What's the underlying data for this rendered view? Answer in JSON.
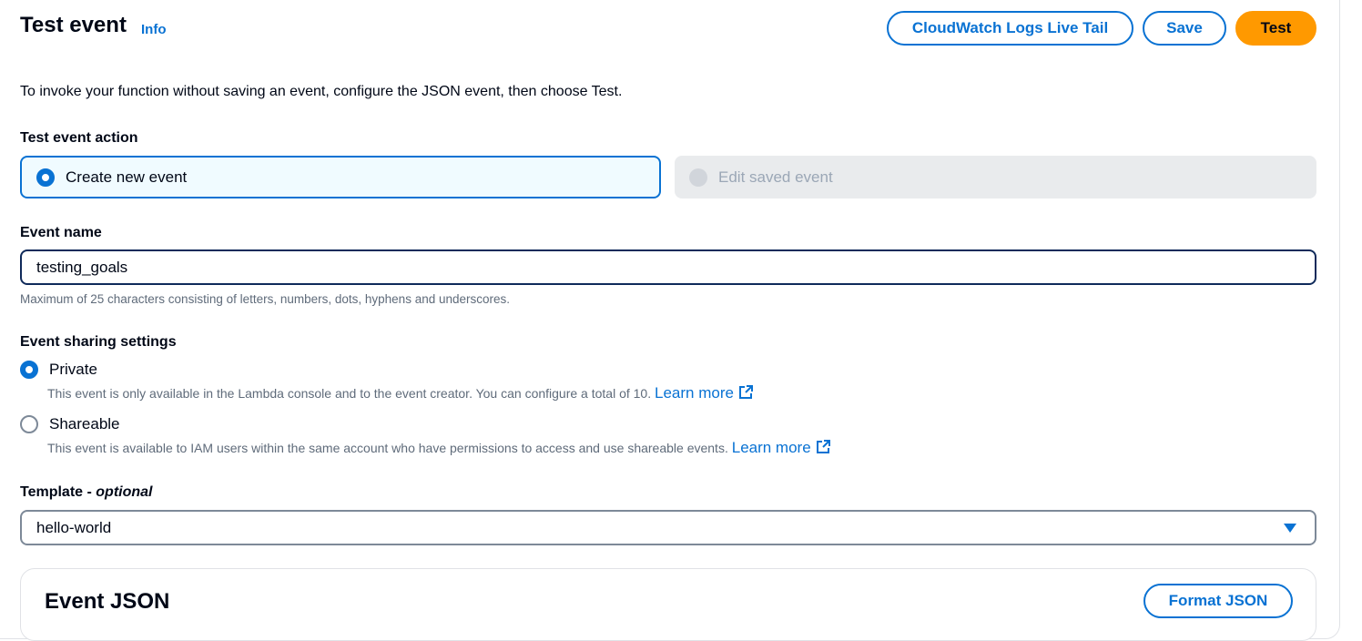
{
  "header": {
    "title": "Test event",
    "info_link": "Info",
    "buttons": {
      "live_tail": "CloudWatch Logs Live Tail",
      "save": "Save",
      "test": "Test"
    }
  },
  "description": "To invoke your function without saving an event, configure the JSON event, then choose Test.",
  "test_event_action": {
    "label": "Test event action",
    "options": [
      {
        "label": "Create new event",
        "selected": true,
        "disabled": false
      },
      {
        "label": "Edit saved event",
        "selected": false,
        "disabled": true
      }
    ]
  },
  "event_name": {
    "label": "Event name",
    "value": "testing_goals",
    "hint": "Maximum of 25 characters consisting of letters, numbers, dots, hyphens and underscores."
  },
  "sharing": {
    "label": "Event sharing settings",
    "options": [
      {
        "label": "Private",
        "selected": true,
        "description": "This event is only available in the Lambda console and to the event creator. You can configure a total of 10.",
        "link": "Learn more"
      },
      {
        "label": "Shareable",
        "selected": false,
        "description": "This event is available to IAM users within the same account who have permissions to access and use shareable events.",
        "link": "Learn more"
      }
    ]
  },
  "template": {
    "label": "Template - ",
    "optional": "optional",
    "selected": "hello-world"
  },
  "event_json": {
    "title": "Event JSON",
    "format_button": "Format JSON"
  },
  "colors": {
    "accent": "#0972d3",
    "primary_button": "#ff9900",
    "focus_border": "#0f2a5a",
    "disabled_bg": "#e9ebed"
  }
}
